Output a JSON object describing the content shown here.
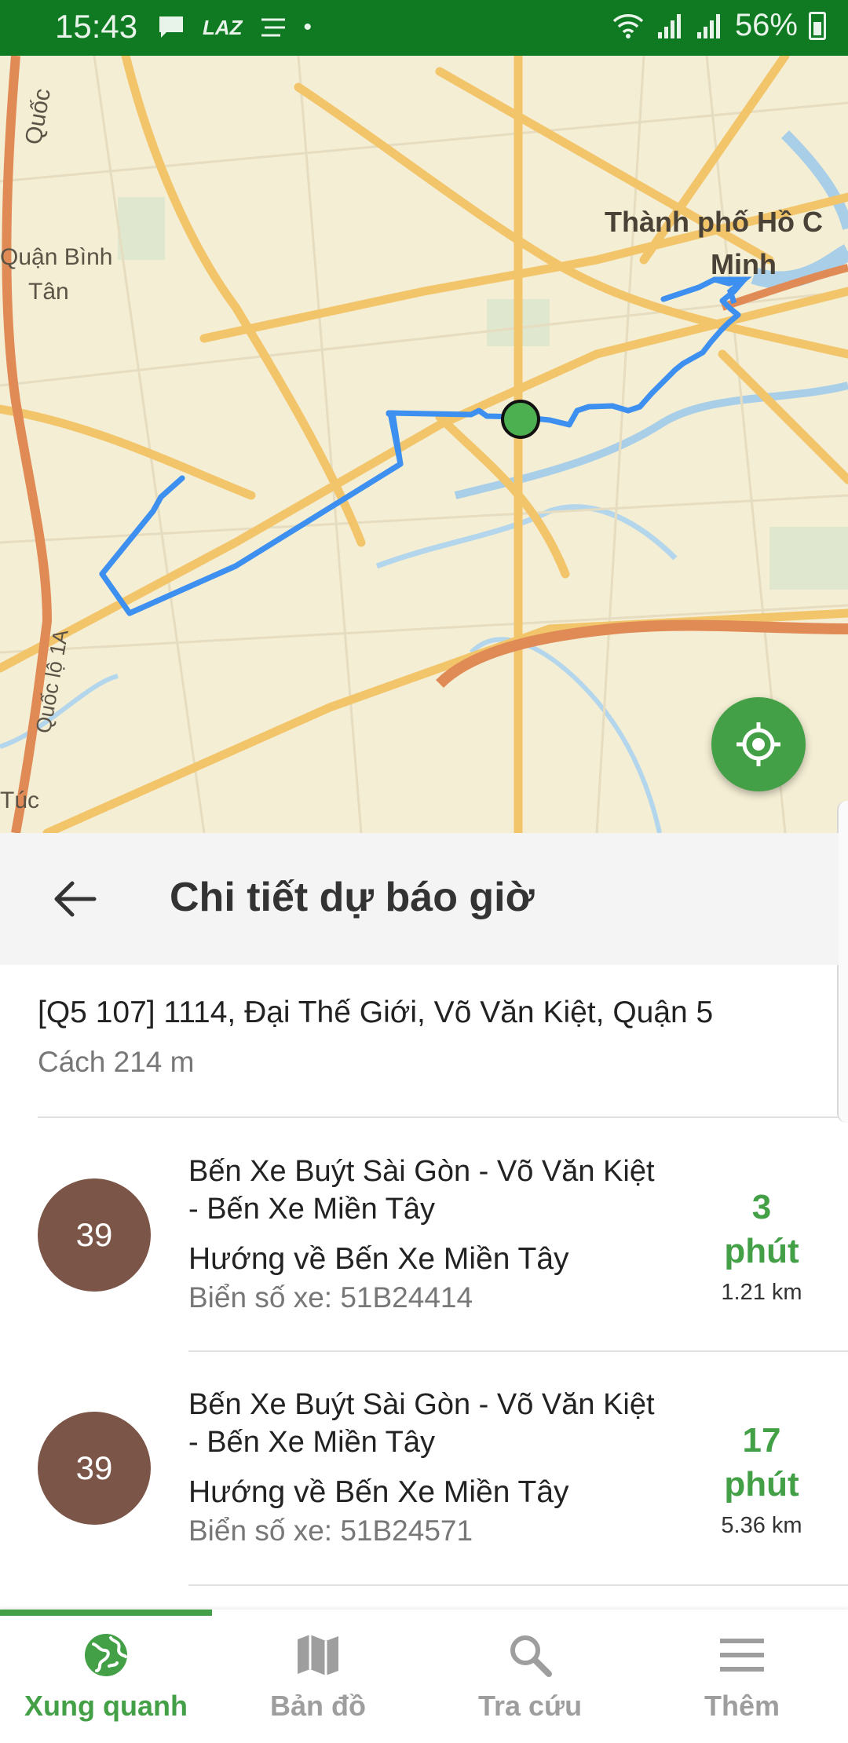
{
  "status_bar": {
    "time": "15:43",
    "battery": "56%"
  },
  "map": {
    "labels": {
      "city_line1": "Thành phố Hồ C",
      "city_line2": "Minh",
      "district_line1": "Quận Bình",
      "district_line2": "Tân",
      "road_top": "Quốc",
      "road_left": "Quốc lộ 1A",
      "bottom_left": "Túc"
    },
    "route_color": "#3d8ff0"
  },
  "header": {
    "title": "Chi tiết dự báo giờ"
  },
  "stop": {
    "name": "[Q5 107] 1114, Đại Thế Giới, Võ Văn Kiệt, Quận 5",
    "distance": "Cách 214 m"
  },
  "arrivals": [
    {
      "route": "39",
      "title_line1": "Bến Xe Buýt Sài Gòn - Võ Văn Kiệt",
      "title_line2": "- Bến Xe Miền Tây",
      "direction": "Hướng về Bến Xe Miền Tây",
      "plate": "Biển số xe: 51B24414",
      "eta_value": "3",
      "eta_unit": "phút",
      "eta_distance": "1.21 km"
    },
    {
      "route": "39",
      "title_line1": "Bến Xe Buýt Sài Gòn - Võ Văn Kiệt",
      "title_line2": "- Bến Xe Miền Tây",
      "direction": "Hướng về Bến Xe Miền Tây",
      "plate": "Biển số xe: 51B24571",
      "eta_value": "17",
      "eta_unit": "phút",
      "eta_distance": "5.36 km"
    }
  ],
  "nav": {
    "items": [
      {
        "label": "Xung quanh",
        "icon": "globe-icon",
        "active": true
      },
      {
        "label": "Bản đồ",
        "icon": "map-icon",
        "active": false
      },
      {
        "label": "Tra cứu",
        "icon": "search-icon",
        "active": false
      },
      {
        "label": "Thêm",
        "icon": "menu-icon",
        "active": false
      }
    ],
    "active_color": "#43a047",
    "inactive_color": "#9e9e9e"
  }
}
